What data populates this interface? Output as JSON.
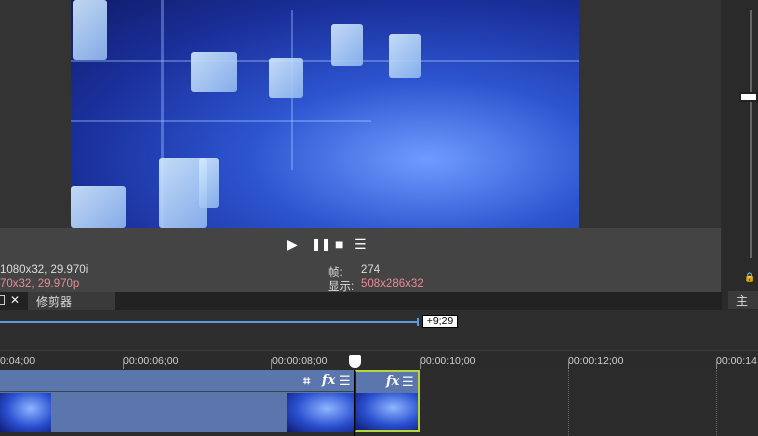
{
  "preview": {
    "controls": {
      "play": "▶",
      "pause": "❚❚",
      "stop": "■",
      "menu": "☰"
    },
    "project_info": "1080x32, 29.970i",
    "preview_info": "70x32, 29.970p",
    "frame_label": "帧:",
    "frame_value": "274",
    "display_label": "显示:",
    "display_value": "508x286x32"
  },
  "tabs": {
    "close_glyph": "✕",
    "trimmer_label": "修剪器"
  },
  "right_panel": {
    "master_label": "主控"
  },
  "timeline": {
    "loop_end_label": "+9;29",
    "ruler_ticks": [
      "0:04;00",
      "00:00:06;00",
      "00:00:08;00",
      "00:00:10;00",
      "00:00:12;00",
      "00:00:14"
    ],
    "clip_icons": {
      "crop": "⌗",
      "fx": "fx",
      "menu": "☰"
    }
  },
  "colors": {
    "accent_pink": "#e88c96",
    "clip_blue": "#5b76ac",
    "selection": "#b7d53a",
    "loop_blue": "#5a9ae0"
  }
}
